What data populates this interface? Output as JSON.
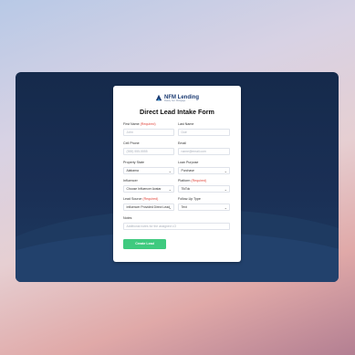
{
  "brand": {
    "name": "NFM Lending",
    "tagline": "Ready. Set. Mortgage."
  },
  "form": {
    "title": "Direct Lead Intake Form",
    "required_marker": "(Required)",
    "first_name": {
      "label": "First Name",
      "placeholder": "John"
    },
    "last_name": {
      "label": "Last Name",
      "placeholder": "Doe"
    },
    "cell_phone": {
      "label": "Cell Phone",
      "placeholder": "(555) 555-5555"
    },
    "email": {
      "label": "Email",
      "placeholder": "name@email.com"
    },
    "property_state": {
      "label": "Property State",
      "value": "Alabama"
    },
    "loan_purpose": {
      "label": "Loan Purpose",
      "value": "Purchase"
    },
    "influencer": {
      "label": "Influencer",
      "value": "Choose Influencer Avatar"
    },
    "platform": {
      "label": "Platform",
      "value": "TikTok"
    },
    "lead_source": {
      "label": "Lead Source",
      "value": "Influencer Provided Direct Lead"
    },
    "follow_up_type": {
      "label": "Follow-Up Type",
      "value": "Text"
    },
    "notes": {
      "label": "Notes",
      "placeholder": "Additional notes for the assigned LO"
    },
    "submit_label": "Create Lead"
  }
}
